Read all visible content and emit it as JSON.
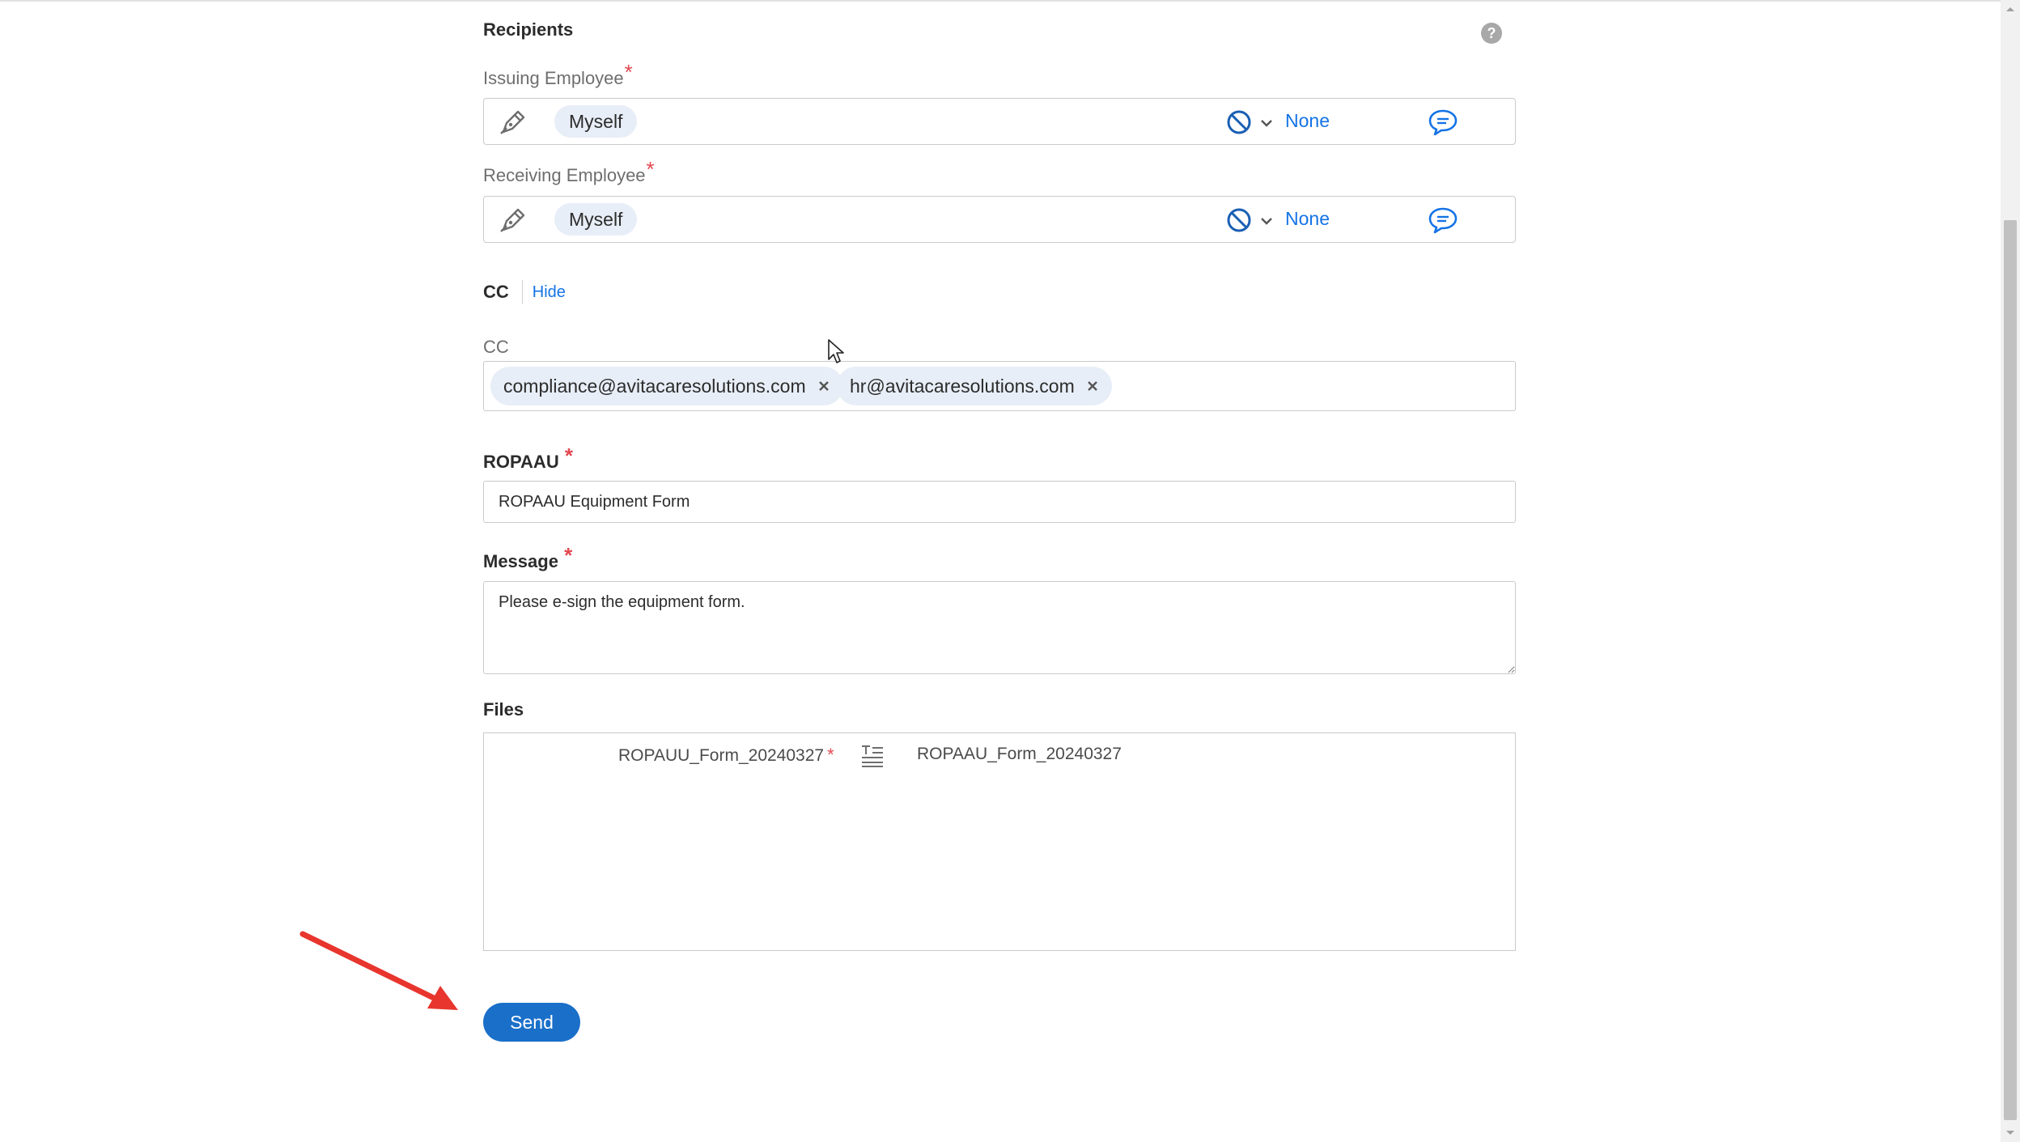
{
  "recipients": {
    "title": "Recipients",
    "help_icon": "question-circle-icon",
    "issuing": {
      "label": "Issuing Employee",
      "required_mark": "*",
      "chip": "Myself",
      "auth_value": "None"
    },
    "receiving": {
      "label": "Receiving Employee",
      "required_mark": "*",
      "chip": "Myself",
      "auth_value": "None"
    }
  },
  "cc": {
    "section_label": "CC",
    "hide_link": "Hide",
    "field_label": "CC",
    "emails": [
      "compliance@avitacaresolutions.com",
      "hr@avitacaresolutions.com"
    ]
  },
  "ropaau": {
    "label": "ROPAAU",
    "required_mark": "*",
    "value": "ROPAAU Equipment Form"
  },
  "message": {
    "label": "Message",
    "required_mark": "*",
    "value": "Please e-sign the equipment form."
  },
  "files": {
    "label": "Files",
    "left_name": "ROPAUU_Form_20240327",
    "left_required_mark": "*",
    "right_name": "ROPAAU_Form_20240327"
  },
  "send_label": "Send",
  "colors": {
    "accent": "#1473e6",
    "button": "#1a6fc9",
    "required": "#e34850",
    "arrow": "#e8352e"
  }
}
